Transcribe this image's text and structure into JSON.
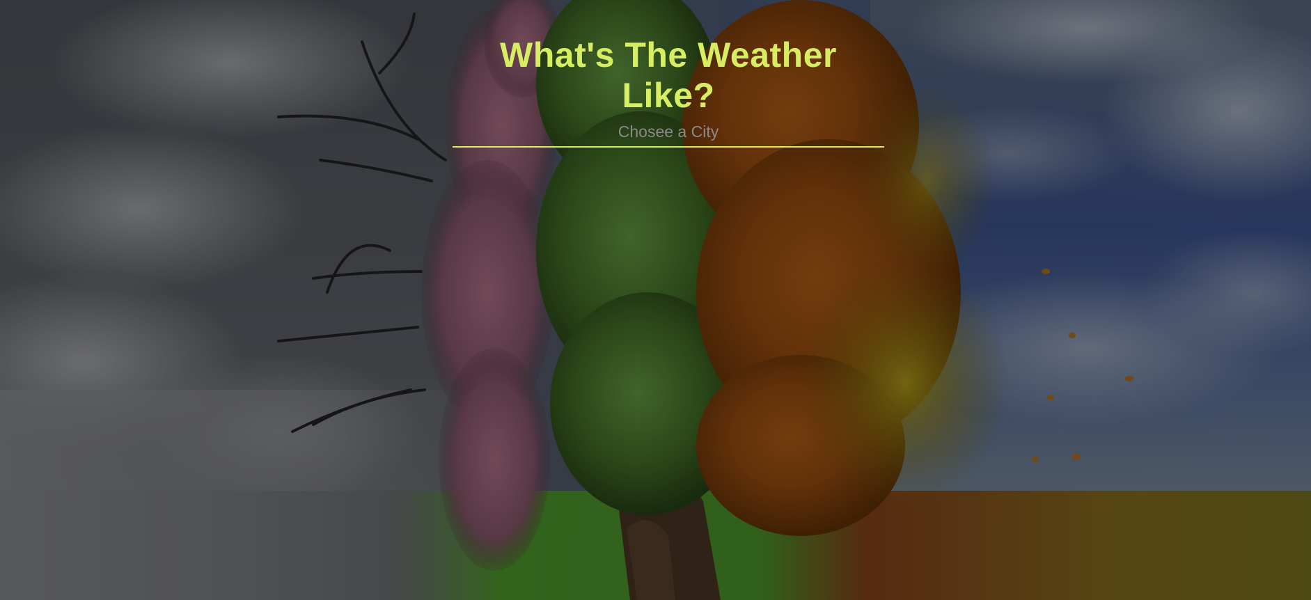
{
  "header": {
    "title": "What's The Weather Like?"
  },
  "search": {
    "placeholder": "Chosee a City",
    "value": ""
  },
  "colors": {
    "accent": "#d7ee63",
    "placeholder": "#8a8a8a"
  },
  "background": {
    "icon": "four-seasons-tree-illustration"
  }
}
